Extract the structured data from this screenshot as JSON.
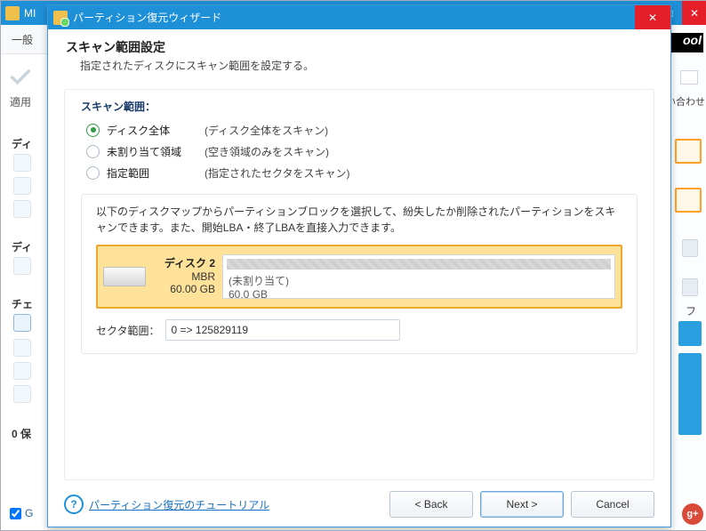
{
  "bg": {
    "parent_title_frag": "MI",
    "tab": "一般",
    "apply": "適用",
    "left_headers": [
      "ディ",
      "ディ",
      "チェ",
      "0 保"
    ],
    "bottom_checkbox": "G",
    "right_tool": "ool",
    "right_label": "い合わせ",
    "right_letter": "フ",
    "gplus": "g+"
  },
  "wizard": {
    "title": "パーティション復元ウィザード",
    "header": {
      "h": "スキャン範囲設定",
      "p": "指定されたディスクにスキャン範囲を設定する。"
    },
    "group_label": "スキャン範囲：",
    "options": [
      {
        "label": "ディスク全体",
        "desc": "(ディスク全体をスキャン)",
        "selected": true
      },
      {
        "label": "未割り当て領域",
        "desc": "(空き領域のみをスキャン)",
        "selected": false
      },
      {
        "label": "指定範囲",
        "desc": "(指定されたセクタをスキャン)",
        "selected": false
      }
    ],
    "desc": "以下のディスクマップからパーティションブロックを選択して、紛失したか削除されたパーティションをスキャンできます。また、開始LBA・終了LBAを直接入力できます。",
    "disk": {
      "name": "ディスク 2",
      "scheme": "MBR",
      "size": "60.00 GB",
      "partition_label": "(未割り当て)",
      "partition_size": "60.0 GB"
    },
    "sector_label": "セクタ範囲：",
    "sector_value": "0 => 125829119",
    "footer": {
      "help": "パーティション復元のチュートリアル",
      "back": "< Back",
      "next": "Next >",
      "cancel": "Cancel"
    }
  }
}
